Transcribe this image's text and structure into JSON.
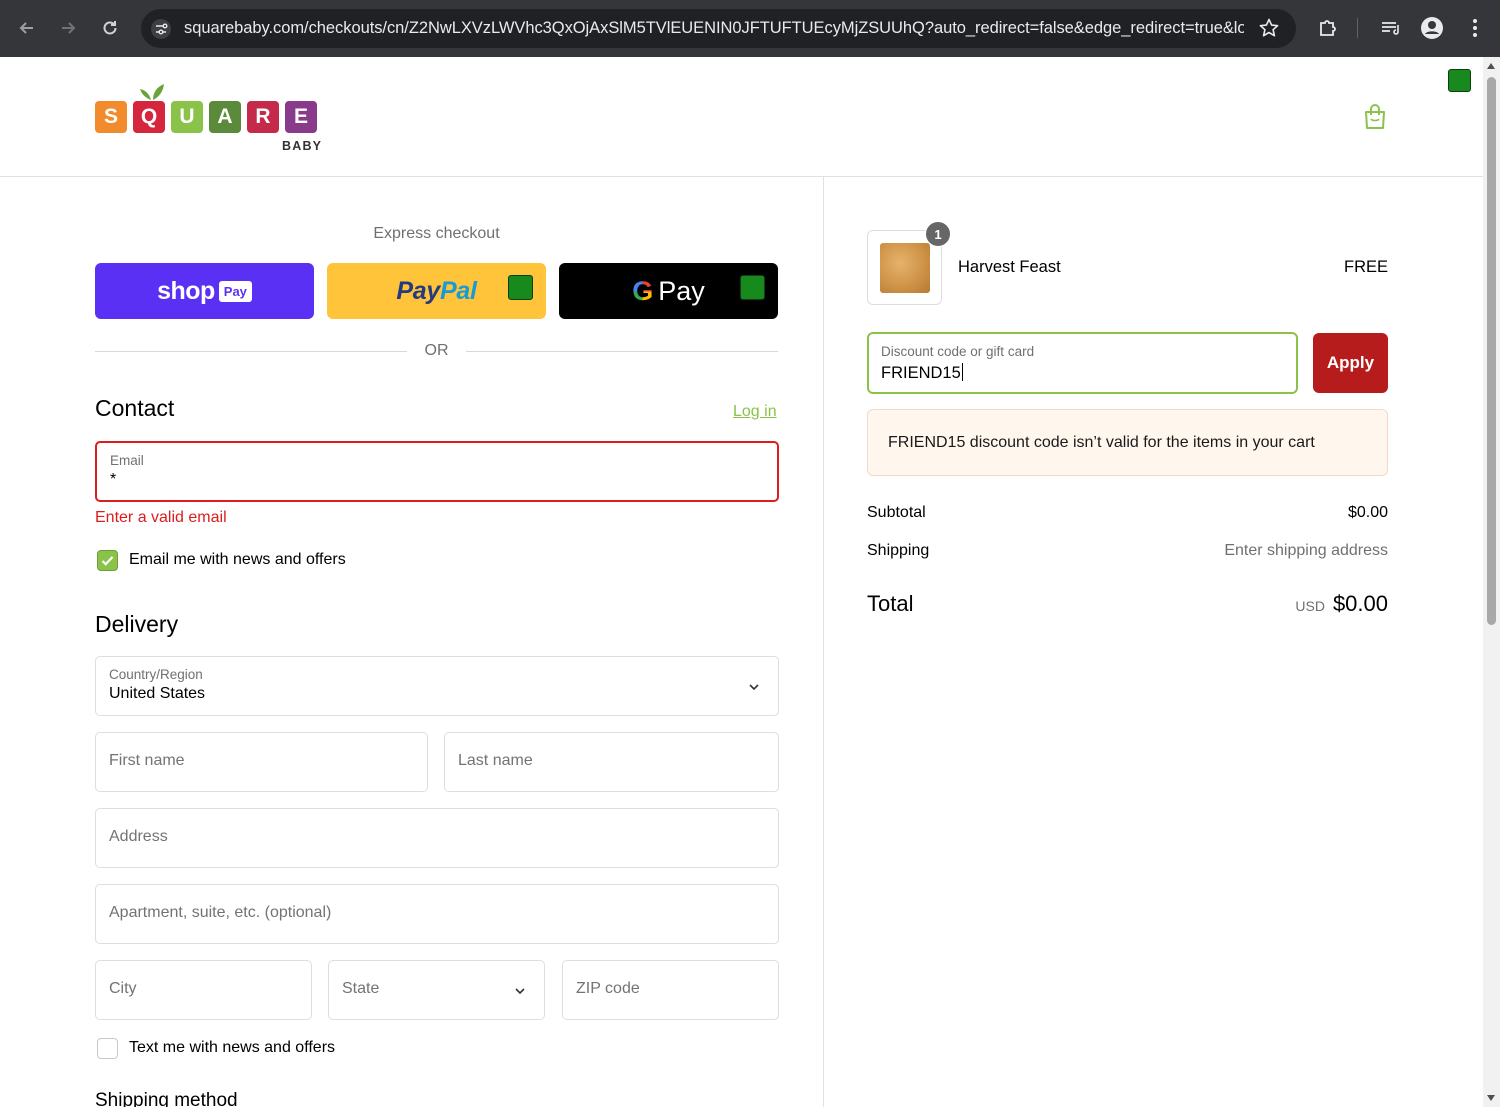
{
  "browser": {
    "url": "squarebaby.com/checkouts/cn/Z2NwLXVzLWVhc3QxOjAxSlM5TVlEUENIN0JFTUFTUEcyMjZSUUhQ?auto_redirect=false&edge_redirect=true&loc..."
  },
  "brand": {
    "letters": [
      "S",
      "Q",
      "U",
      "A",
      "R",
      "E"
    ],
    "letter_colors": [
      "#f28a2e",
      "#d6263d",
      "#8bc34a",
      "#5a8a3a",
      "#c62a4a",
      "#8a3a8a"
    ],
    "sub": "BABY"
  },
  "express": {
    "label": "Express checkout",
    "shop_word": "shop",
    "shop_badge": "Pay",
    "paypal_a": "Pay",
    "paypal_b": "Pal",
    "gpay_g": "G",
    "gpay_word": "Pay"
  },
  "or_label": "OR",
  "contact": {
    "heading": "Contact",
    "login": "Log in",
    "email_label": "Email",
    "email_value": "*",
    "error": "Enter a valid email",
    "newsletter": "Email me with news and offers",
    "newsletter_checked": true
  },
  "delivery": {
    "heading": "Delivery",
    "country_label": "Country/Region",
    "country_value": "United States",
    "first_name": "First name",
    "last_name": "Last name",
    "address": "Address",
    "apartment": "Apartment, suite, etc. (optional)",
    "city": "City",
    "state": "State",
    "zip": "ZIP code",
    "sms": "Text me with news and offers",
    "sms_checked": false
  },
  "shipping_heading": "Shipping method",
  "order": {
    "quantity": "1",
    "item_name": "Harvest Feast",
    "item_price": "FREE",
    "discount_label": "Discount code or gift card",
    "discount_value": "FRIEND15",
    "apply": "Apply",
    "notice": "FRIEND15 discount code isn’t valid for the items in your cart",
    "subtotal_label": "Subtotal",
    "subtotal_value": "$0.00",
    "shipping_label": "Shipping",
    "shipping_value": "Enter shipping address",
    "total_label": "Total",
    "currency": "USD",
    "total_value": "$0.00"
  },
  "colors": {
    "accent_green": "#8bc34a",
    "error_red": "#dd1d1d",
    "apply_red": "#b71c1c",
    "shop_purple": "#5a31f4",
    "paypal_yellow": "#ffc439"
  }
}
